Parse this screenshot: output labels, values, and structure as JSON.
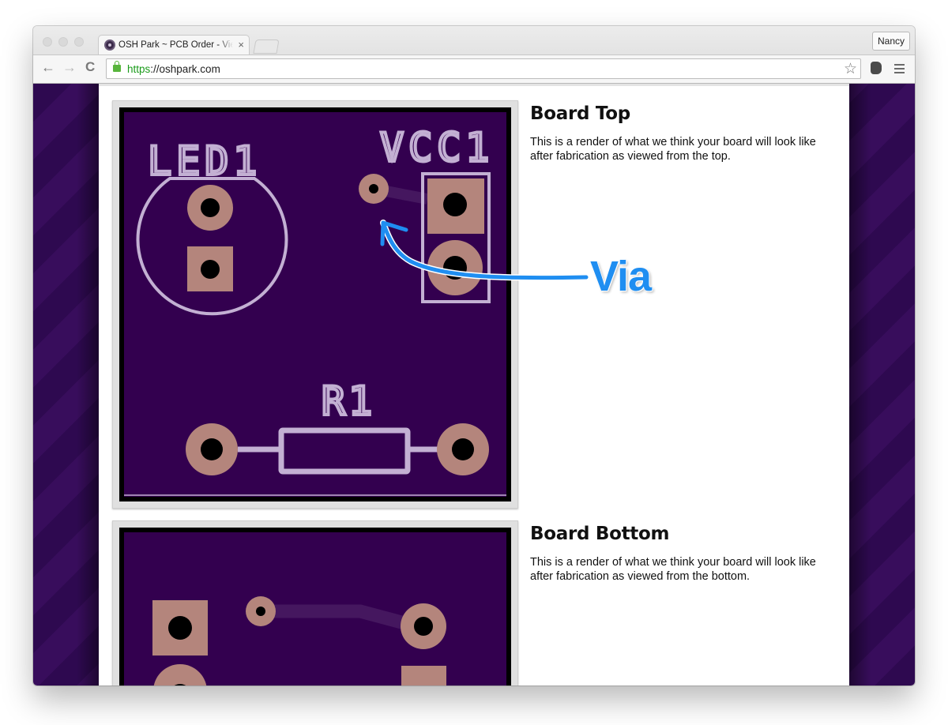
{
  "browser": {
    "tab_title": "OSH Park ~ PCB Order - View Order",
    "tab_close": "×",
    "profile_name": "Nancy",
    "url_scheme": "https",
    "url_rest": "://oshpark.com",
    "icons": {
      "back": "←",
      "forward": "→",
      "reload": "C",
      "star": "☆"
    }
  },
  "sections": [
    {
      "title": "Board Top",
      "description": "This is a render of what we think your board will look like after fabrication as viewed from the top."
    },
    {
      "title": "Board Bottom",
      "description": "This is a render of what we think your board will look like after fabrication as viewed from the bottom."
    }
  ],
  "board_top": {
    "labels": {
      "led": "LED1",
      "vcc": "VCC1",
      "resistor": "R1"
    }
  },
  "annotation": {
    "label": "Via",
    "color": "#1f8ef1"
  },
  "colors": {
    "board": "#33004f",
    "silkscreen": "#c3b0d3",
    "copper_pad": "#b4857c",
    "trace": "#45175f",
    "background_stripe_a": "#2e0950",
    "background_stripe_b": "#380d5c"
  }
}
